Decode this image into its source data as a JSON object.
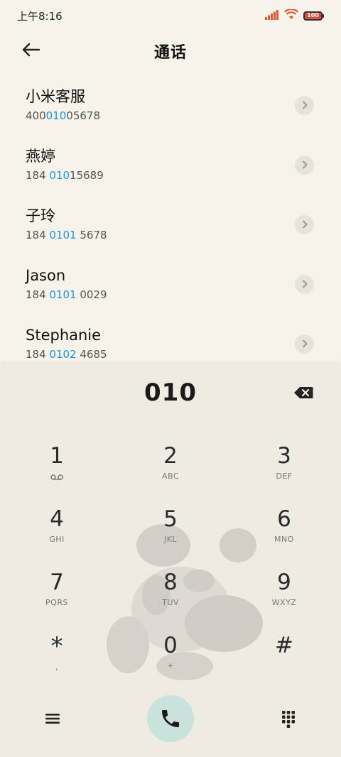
{
  "status_bar": {
    "time": "上午8:16",
    "battery_level": "100",
    "signal_icon": "signal-icon",
    "wifi_icon": "wifi-icon"
  },
  "header": {
    "title": "通话",
    "back_icon": "back-arrow-icon"
  },
  "contacts": [
    {
      "name": "小米客服",
      "number_parts": [
        "400",
        "010",
        "05678"
      ]
    },
    {
      "name": "燕婷",
      "number_parts": [
        "184 ",
        "010",
        "15689"
      ]
    },
    {
      "name": "子玲",
      "number_parts": [
        "184 ",
        "0101",
        " 5678"
      ]
    },
    {
      "name": "Jason",
      "number_parts": [
        "184 ",
        "0101",
        " 0029"
      ]
    },
    {
      "name": "Stephanie",
      "number_parts": [
        "184 ",
        "0102",
        " 4685"
      ]
    }
  ],
  "dialpad": {
    "input_value": "010",
    "keys": [
      {
        "digit": "1",
        "letters": ""
      },
      {
        "digit": "2",
        "letters": "ABC"
      },
      {
        "digit": "3",
        "letters": "DEF"
      },
      {
        "digit": "4",
        "letters": "GHI"
      },
      {
        "digit": "5",
        "letters": "JKL"
      },
      {
        "digit": "6",
        "letters": "MNO"
      },
      {
        "digit": "7",
        "letters": "PQRS"
      },
      {
        "digit": "8",
        "letters": "TUV"
      },
      {
        "digit": "9",
        "letters": "WXYZ"
      },
      {
        "digit": "*",
        "letters": ","
      },
      {
        "digit": "0",
        "letters": "+"
      },
      {
        "digit": "#",
        "letters": ""
      }
    ]
  },
  "colors": {
    "highlight": "#1b94e3",
    "call_button_bg": "#c8e3dc",
    "background": "#f6f3ea"
  }
}
